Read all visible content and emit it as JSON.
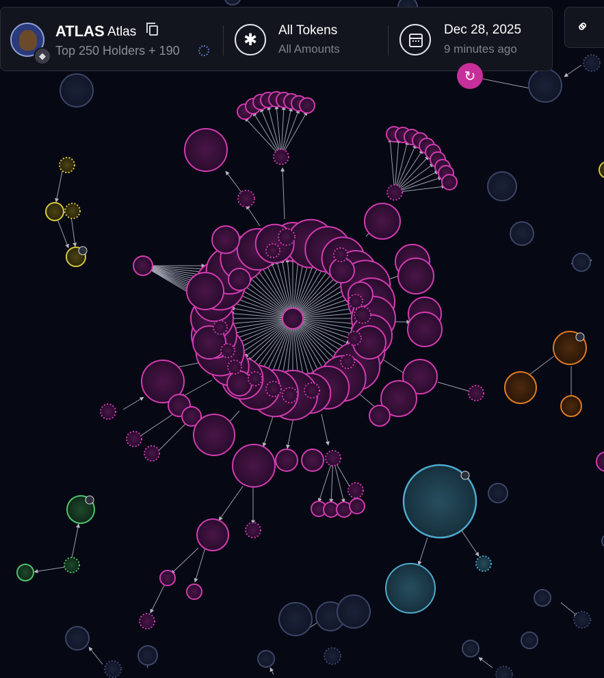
{
  "token": {
    "symbol": "ATLAS",
    "name": "Atlas",
    "subtitle": "Top 250 Holders + 190"
  },
  "filter": {
    "title": "All Tokens",
    "subtitle": "All Amounts",
    "icon": "asterisk-icon"
  },
  "date": {
    "title": "Dec 28, 2025",
    "subtitle": "9 minutes ago",
    "icon": "calendar-icon"
  },
  "icons": {
    "copy": "copy-icon",
    "refresh": "refresh-icon",
    "link": "link-icon",
    "chain": "ethereum-icon",
    "lock": "lock-icon",
    "swap": "swap-icon"
  },
  "colors": {
    "magenta": "#d23bb0",
    "blue": "#3e4e78",
    "yellow": "#d9c93a",
    "orange": "#e07b22",
    "green": "#4ec46a",
    "cyan": "#4eabd0",
    "background": "#060814"
  }
}
